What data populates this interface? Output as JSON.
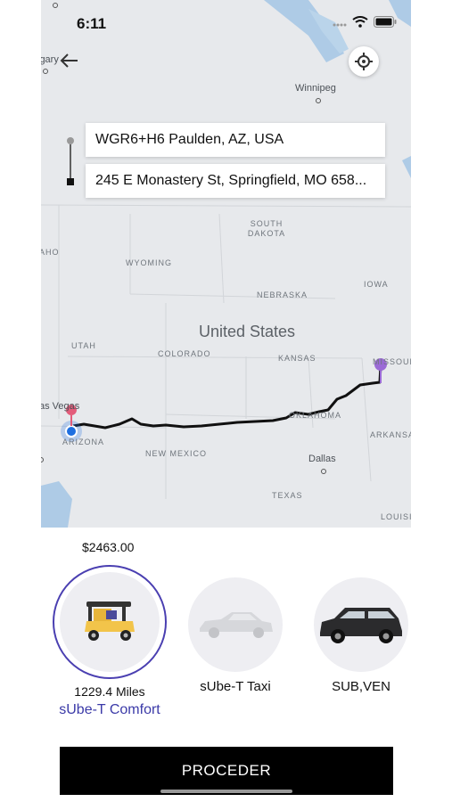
{
  "status": {
    "time": "6:11"
  },
  "route": {
    "origin": "WGR6+H6 Paulden, AZ, USA",
    "destination": "245 E Monastery St, Springfield, MO 658..."
  },
  "map_labels": {
    "calgary": "lgary",
    "winnipeg": "Winnipeg",
    "south_dakota": "SOUTH DAKOTA",
    "idaho": "AHO",
    "wyoming": "WYOMING",
    "nebraska": "NEBRASKA",
    "iowa": "IOWA",
    "utah": "UTAH",
    "united_states": "United States",
    "colorado": "COLORADO",
    "kansas": "KANSAS",
    "missouri": "MISSOUR",
    "las_vegas": "as Vegas",
    "oklahoma": "OKLAHOMA",
    "arkansas": "ARKANSA",
    "arizona": "ARIZONA",
    "new_mexico": "NEW MEXICO",
    "dallas": "Dallas",
    "texas": "TEXAS",
    "louisiana": "LOUISI"
  },
  "fare": {
    "price": "$2463.00"
  },
  "vehicles": [
    {
      "name": "sUbe-T Comfort",
      "distance": "1229.4 Miles",
      "selected": true
    },
    {
      "name": "sUbe-T Taxi",
      "selected": false
    },
    {
      "name": "SUB,VEN",
      "selected": false
    }
  ],
  "proceed_label": "PROCEDER",
  "colors": {
    "accent": "#3b3aa8",
    "route_line": "#111111",
    "origin_pin": "#1e6fe0",
    "dest_pin": "#9b6ad6"
  }
}
